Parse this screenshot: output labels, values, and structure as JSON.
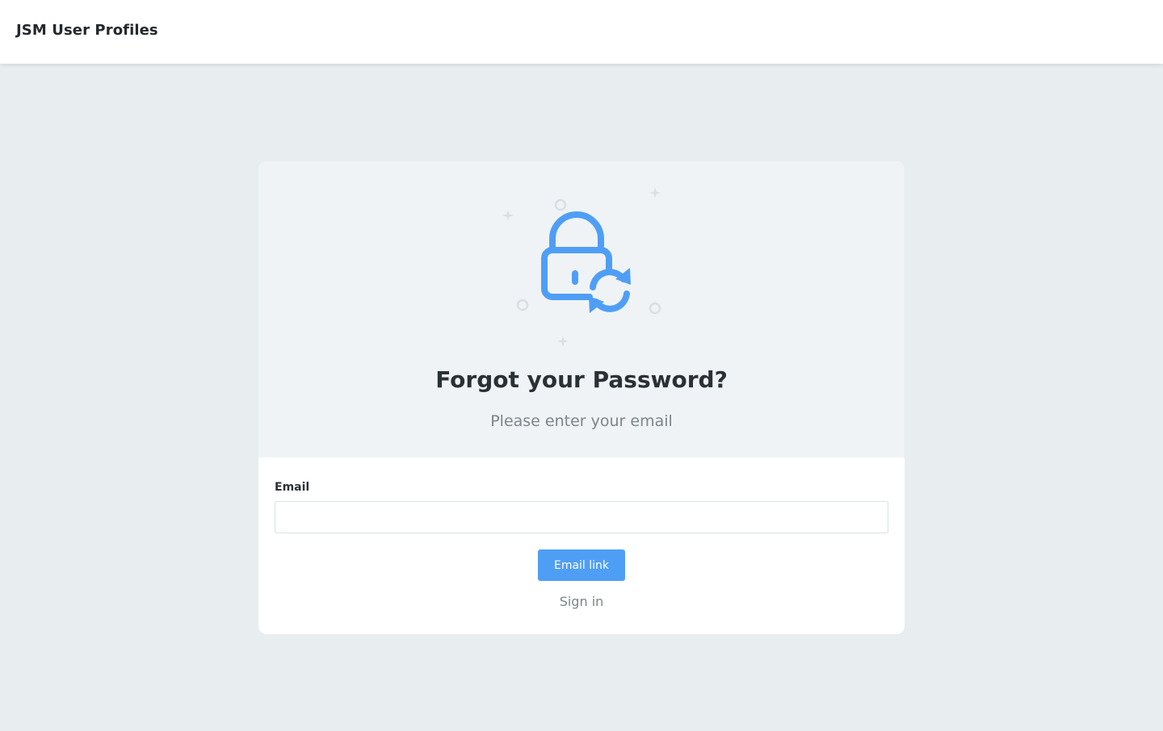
{
  "header": {
    "brand": "JSM User Profiles"
  },
  "card": {
    "illustration_icon": "lock-reset-icon",
    "title": "Forgot your Password?",
    "subtitle": "Please enter your email"
  },
  "form": {
    "email_label": "Email",
    "email_value": "",
    "email_placeholder": "",
    "submit_label": "Email link",
    "signin_label": "Sign in"
  },
  "colors": {
    "accent": "#4f9ef6",
    "page_background": "#e8edf0",
    "hero_background": "#eff3f5",
    "decor": "#d8dee2"
  }
}
